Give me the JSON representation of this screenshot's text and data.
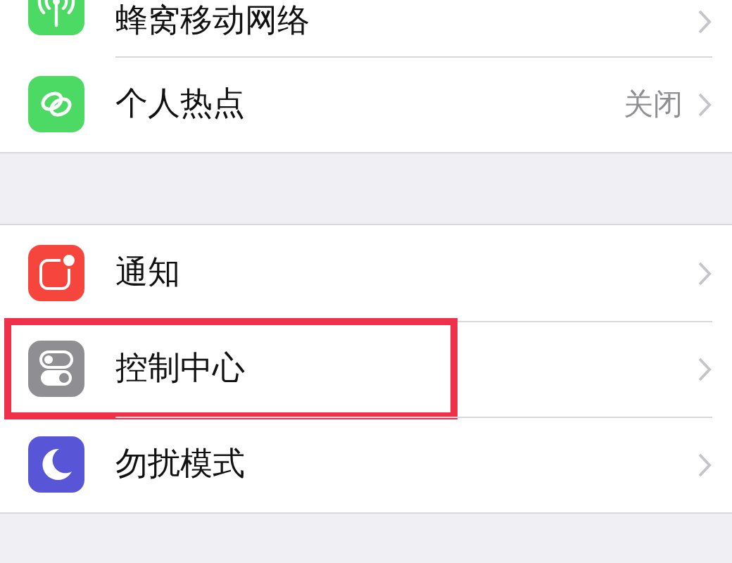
{
  "sections": [
    {
      "items": [
        {
          "kind": "cellular",
          "label": "蜂窝移动网络",
          "highlighted": false
        },
        {
          "kind": "hotspot",
          "label": "个人热点",
          "value": "关闭",
          "highlighted": false
        }
      ]
    },
    {
      "items": [
        {
          "kind": "notifications",
          "label": "通知",
          "highlighted": false
        },
        {
          "kind": "control",
          "label": "控制中心",
          "highlighted": true
        },
        {
          "kind": "moon",
          "label": "勿扰模式",
          "highlighted": false
        }
      ]
    }
  ]
}
